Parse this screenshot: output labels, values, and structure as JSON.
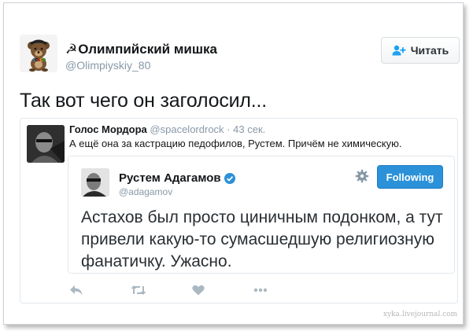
{
  "author": {
    "symbol": "☭",
    "name": "Олимпийский мишка",
    "handle": "@Olimpiyskiy_80"
  },
  "follow_button": {
    "label": "Читать",
    "icon": "add-user-icon"
  },
  "tweet": {
    "text": "Так вот чего он заголосил..."
  },
  "quote": {
    "name": "Голос Мордора",
    "handle": "@spacelordrock",
    "separator": "·",
    "time": "43 сек.",
    "text": "А ещё она за кастрацию педофилов, Рустем. Причём не химическую.",
    "inner": {
      "name": "Рустем Адагамов",
      "handle": "@adagamov",
      "following_label": "Following",
      "text": "Астахов был просто циничным подонком, а тут привели какую-то сумасшедшую религиозную фанатичку. Ужасно."
    }
  },
  "actions": [
    "reply-icon",
    "retweet-icon",
    "like-icon",
    "more-icon"
  ],
  "watermark": "xyka.livejournal.com",
  "colors": {
    "accent": "#2b91d9",
    "muted": "#8899a6",
    "text": "#14171a",
    "icon": "#aab8c2"
  }
}
